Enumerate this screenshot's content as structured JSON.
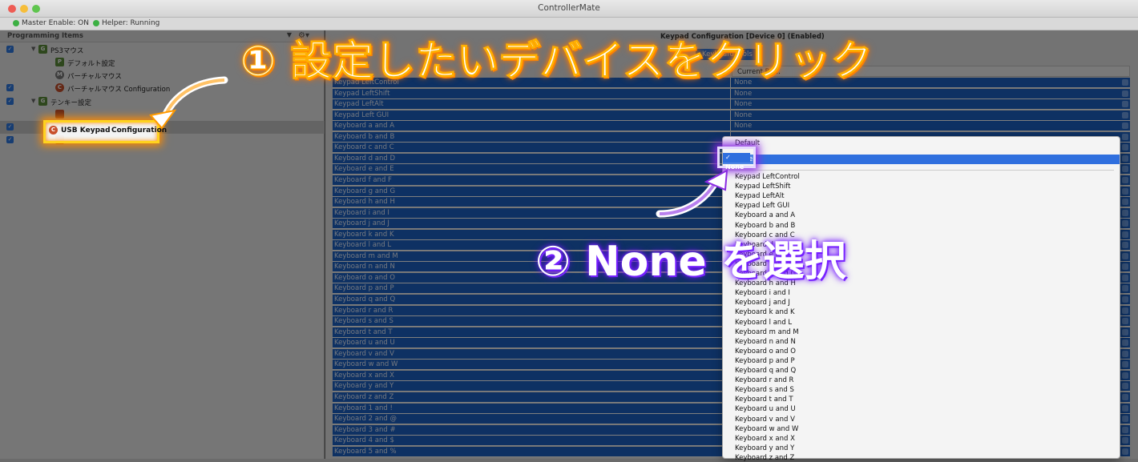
{
  "window": {
    "title": "ControllerMate"
  },
  "status": {
    "master": "Master Enable: ON",
    "helper": "Helper: Running"
  },
  "sidebar": {
    "header": "Programming Items",
    "items": [
      {
        "label": "PS3マウス",
        "icon": "G",
        "icon_color": "#5d8f3a",
        "level": 0,
        "expanded": true
      },
      {
        "label": "デフォルト設定",
        "icon": "P",
        "icon_color": "#5d8f3a",
        "level": 1
      },
      {
        "label": "パーチャルマウス",
        "icon": "M",
        "icon_color": "#7a7a7a",
        "level": 1
      },
      {
        "label": "バーチャルマウス Configuration",
        "icon": "C",
        "icon_color": "#c8502c",
        "level": 1
      },
      {
        "label": "テンキー設定",
        "icon": "G",
        "icon_color": "#5d8f3a",
        "level": 0,
        "expanded": true
      },
      {
        "label": "",
        "icon": "",
        "icon_color": "#c8502c",
        "level": 1
      },
      {
        "label": "USB Keypad",
        "label2": "Configuration",
        "icon": "C",
        "icon_color": "#c8502c",
        "level": 1,
        "selected": true
      },
      {
        "label": "",
        "icon": "",
        "icon_color": "#c8502c",
        "level": 1
      }
    ]
  },
  "main": {
    "header": "Keypad Configuration [Device 0] (Enabled)",
    "segment": "Keyboard ...ols",
    "column_header": "Current Be...",
    "rows": [
      {
        "key": "Keypad LeftControl",
        "value": "None"
      },
      {
        "key": "Keypad LeftShift",
        "value": "None"
      },
      {
        "key": "Keypad LeftAlt",
        "value": "None"
      },
      {
        "key": "Keypad Left GUI",
        "value": "None"
      },
      {
        "key": "Keyboard a and A",
        "value": "None"
      },
      {
        "key": "Keyboard b and B",
        "value": ""
      },
      {
        "key": "Keyboard c and C",
        "value": ""
      },
      {
        "key": "Keyboard d and D",
        "value": ""
      },
      {
        "key": "Keyboard e and E",
        "value": ""
      },
      {
        "key": "Keyboard f and F",
        "value": ""
      },
      {
        "key": "Keyboard g and G",
        "value": ""
      },
      {
        "key": "Keyboard h and H",
        "value": ""
      },
      {
        "key": "Keyboard i and I",
        "value": ""
      },
      {
        "key": "Keyboard j and J",
        "value": ""
      },
      {
        "key": "Keyboard k and K",
        "value": ""
      },
      {
        "key": "Keyboard l and L",
        "value": ""
      },
      {
        "key": "Keyboard m and M",
        "value": ""
      },
      {
        "key": "Keyboard n and N",
        "value": ""
      },
      {
        "key": "Keyboard o and O",
        "value": ""
      },
      {
        "key": "Keyboard p and P",
        "value": ""
      },
      {
        "key": "Keyboard q and Q",
        "value": ""
      },
      {
        "key": "Keyboard r and R",
        "value": ""
      },
      {
        "key": "Keyboard s and S",
        "value": ""
      },
      {
        "key": "Keyboard t and T",
        "value": ""
      },
      {
        "key": "Keyboard u and U",
        "value": ""
      },
      {
        "key": "Keyboard v and V",
        "value": ""
      },
      {
        "key": "Keyboard w and W",
        "value": ""
      },
      {
        "key": "Keyboard x and X",
        "value": ""
      },
      {
        "key": "Keyboard y and Y",
        "value": ""
      },
      {
        "key": "Keyboard z and Z",
        "value": ""
      },
      {
        "key": "Keyboard 1 and !",
        "value": ""
      },
      {
        "key": "Keyboard 2 and @",
        "value": ""
      },
      {
        "key": "Keyboard 3 and #",
        "value": ""
      },
      {
        "key": "Keyboard 4 and $",
        "value": ""
      },
      {
        "key": "Keyboard 5 and %",
        "value": ""
      }
    ]
  },
  "popup": {
    "default": "Default",
    "selected": "None",
    "items": [
      "Keypad LeftControl",
      "Keypad LeftShift",
      "Keypad LeftAlt",
      "Keypad Left GUI",
      "Keyboard a and A",
      "Keyboard b and B",
      "Keyboard c and C",
      "Keyboard d and D",
      "Keyboard e and E",
      "Keyboard f and F",
      "Keyboard g and G",
      "Keyboard h and H",
      "Keyboard i and I",
      "Keyboard j and J",
      "Keyboard k and K",
      "Keyboard l and L",
      "Keyboard m and M",
      "Keyboard n and N",
      "Keyboard o and O",
      "Keyboard p and P",
      "Keyboard q and Q",
      "Keyboard r and R",
      "Keyboard s and S",
      "Keyboard t and T",
      "Keyboard u and U",
      "Keyboard v and V",
      "Keyboard w and W",
      "Keyboard x and X",
      "Keyboard y and Y",
      "Keyboard z and Z"
    ]
  },
  "annotations": {
    "step1": "① 設定したいデバイスをクリック",
    "step2": "② None を選択",
    "step1_color": "#ff8a00",
    "step2_color": "#7b2cff"
  }
}
